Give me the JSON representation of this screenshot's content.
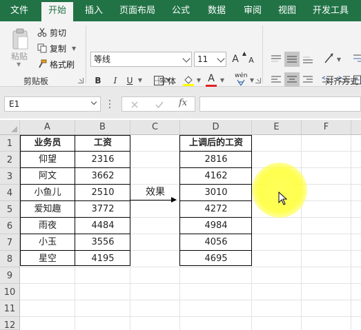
{
  "ribbon_tabs": [
    "文件",
    "开始",
    "插入",
    "页面布局",
    "公式",
    "数据",
    "审阅",
    "视图",
    "开发工具"
  ],
  "active_tab": "开始",
  "clipboard": {
    "paste_label": "粘贴",
    "cut_label": "剪切",
    "copy_label": "复制",
    "format_painter_label": "格式刷",
    "group_label": "剪贴板"
  },
  "font": {
    "font_name": "等线",
    "font_size": "11",
    "grow_label": "A",
    "shrink_label": "A",
    "bold_label": "B",
    "italic_label": "I",
    "underline_label": "U",
    "font_color_label": "A",
    "phonetic_label": "wén",
    "group_label": "字体"
  },
  "alignment": {
    "group_label": "对齐方式"
  },
  "formula_bar": {
    "name_box": "E1",
    "formula": ""
  },
  "columns": [
    "A",
    "B",
    "C",
    "D",
    "E",
    "F"
  ],
  "rows": [
    "1",
    "2",
    "3",
    "4",
    "5",
    "6",
    "7",
    "8",
    "9",
    "10",
    "11",
    "12"
  ],
  "sheet": {
    "headers": {
      "A": "业务员",
      "B": "工资",
      "D": "上调后的工资"
    },
    "records": [
      {
        "name": "仰望",
        "salary": "2316",
        "raised": "2816"
      },
      {
        "name": "阿文",
        "salary": "3662",
        "raised": "4162"
      },
      {
        "name": "小鱼儿",
        "salary": "2510",
        "raised": "3010"
      },
      {
        "name": "爱知趣",
        "salary": "3772",
        "raised": "4272"
      },
      {
        "name": "雨夜",
        "salary": "4484",
        "raised": "4984"
      },
      {
        "name": "小玉",
        "salary": "3556",
        "raised": "4056"
      },
      {
        "name": "星空",
        "salary": "4195",
        "raised": "4695"
      }
    ],
    "effect_label": "效果"
  },
  "colors": {
    "ribbon_green": "#217346",
    "highlight": "#ffff50"
  }
}
